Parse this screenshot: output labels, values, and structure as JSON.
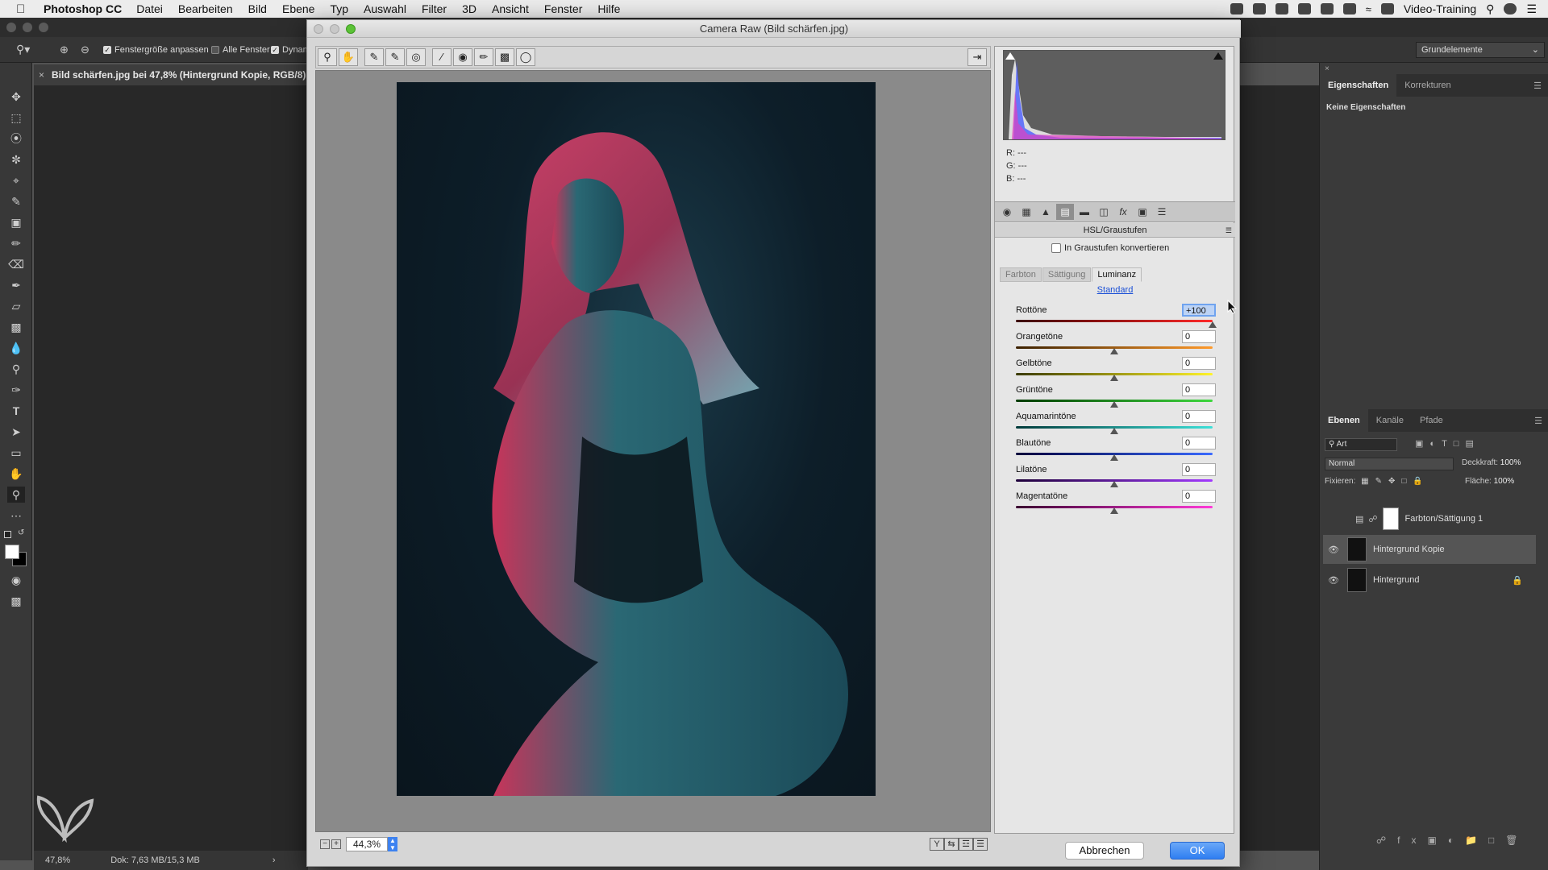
{
  "menubar": {
    "app_name": "Photoshop CC",
    "items": [
      "Datei",
      "Bearbeiten",
      "Bild",
      "Ebene",
      "Typ",
      "Auswahl",
      "Filter",
      "3D",
      "Ansicht",
      "Fenster",
      "Hilfe"
    ],
    "user": "Video-Training"
  },
  "options_bar": {
    "fit_window_label": "Fenstergröße anpassen",
    "all_windows_label": "Alle Fenster",
    "dynamic_label": "Dynam",
    "workspace": "Grundelemente"
  },
  "document": {
    "tab_title": "Bild schärfen.jpg bei 47,8% (Hintergrund Kopie, RGB/8)",
    "zoom": "47,8%",
    "doc_size": "Dok: 7,63 MB/15,3 MB"
  },
  "properties_panel": {
    "tabs": [
      "Eigenschaften",
      "Korrekturen"
    ],
    "empty_text": "Keine Eigenschaften"
  },
  "layers_panel": {
    "tabs": [
      "Ebenen",
      "Kanäle",
      "Pfade"
    ],
    "filter_label": "Art",
    "blend_mode": "Normal",
    "opacity_label": "Deckkraft:",
    "opacity_value": "100%",
    "lock_label": "Fixieren:",
    "fill_label": "Fläche:",
    "fill_value": "100%",
    "layers": [
      {
        "name": "Farbton/Sättigung 1",
        "visible": false,
        "selected": false
      },
      {
        "name": "Hintergrund Kopie",
        "visible": true,
        "selected": true
      },
      {
        "name": "Hintergrund",
        "visible": true,
        "selected": false,
        "locked": true
      }
    ]
  },
  "camera_raw": {
    "title": "Camera Raw (Bild schärfen.jpg)",
    "zoom_value": "44,3%",
    "rgb_readout": {
      "r": "R:  ---",
      "g": "G:  ---",
      "b": "B:  ---"
    },
    "panel_title": "HSL/Graustufen",
    "grayscale_label": "In Graustufen konvertieren",
    "subtabs": [
      "Farbton",
      "Sättigung",
      "Luminanz"
    ],
    "active_subtab": "Luminanz",
    "default_link": "Standard",
    "sliders": [
      {
        "label": "Rottöne",
        "value": "+100",
        "num": 100,
        "track": "linear-gradient(90deg,#3a0000,#ff2a2a)"
      },
      {
        "label": "Orangetöne",
        "value": "0",
        "num": 0,
        "track": "linear-gradient(90deg,#3a2000,#ff9a2a)"
      },
      {
        "label": "Gelbtöne",
        "value": "0",
        "num": 0,
        "track": "linear-gradient(90deg,#3a3a00,#fff32a)"
      },
      {
        "label": "Grüntöne",
        "value": "0",
        "num": 0,
        "track": "linear-gradient(90deg,#003a00,#3ed83e)"
      },
      {
        "label": "Aquamarintöne",
        "value": "0",
        "num": 0,
        "track": "linear-gradient(90deg,#003a3a,#3ee0d8)"
      },
      {
        "label": "Blautöne",
        "value": "0",
        "num": 0,
        "track": "linear-gradient(90deg,#00003a,#3a6aff)"
      },
      {
        "label": "Lilatöne",
        "value": "0",
        "num": 0,
        "track": "linear-gradient(90deg,#1e003a,#a23aff)"
      },
      {
        "label": "Magentatöne",
        "value": "0",
        "num": 0,
        "track": "linear-gradient(90deg,#3a0030,#ff3ad8)"
      }
    ],
    "cancel_label": "Abbrechen",
    "ok_label": "OK"
  },
  "colors": {
    "accent_blue": "#2f7ef1",
    "link_blue": "#1a4fd6"
  }
}
